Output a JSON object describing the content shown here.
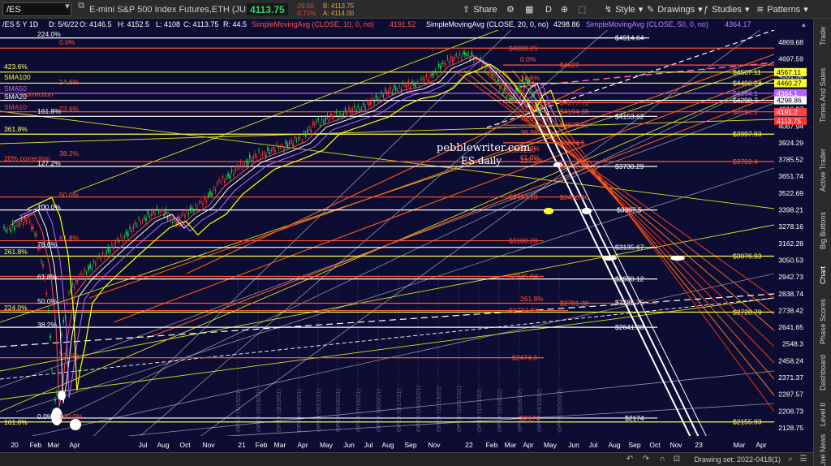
{
  "toolbar": {
    "symbol": "/ES",
    "description": "E-mini S&P 500 Index Futures,ETH (JUN 22)",
    "last_price": "4113.75",
    "change": "-29.50",
    "change_pct": "-0.71%",
    "bid": "B: 4113.75",
    "ask": "A: 4114.00",
    "share_label": "Share",
    "aggregation_label": "D",
    "style_label": "Style",
    "drawings_label": "Drawings",
    "studies_label": "Studies",
    "patterns_label": "Patterns"
  },
  "side_tabs": [
    "Trade",
    "Times And Sales",
    "Active Trader",
    "Big Buttons",
    "Chart",
    "Phase Scores",
    "Dashboard",
    "Level II",
    "Live News"
  ],
  "chart_header": {
    "title": "/ES 5 Y 1D",
    "date": "D: 5/6/22",
    "open": "O: 4146.5",
    "high": "H: 4152.5",
    "low": "L: 4108",
    "close": "C: 4113.75",
    "range": "R: 44.5",
    "sma10_label": "SimpleMovingAvg (CLOSE, 10, 0, no)",
    "sma10_value": "4191.52",
    "sma20_label": "SimpleMovingAvg (CLOSE, 20, 0, no)",
    "sma20_value": "4298.86",
    "sma50_label": "SimpleMovingAvg (CLOSE, 50, 0, no)",
    "sma50_value": "4364.17",
    "colors": {
      "sma10": "#ff4d4d",
      "sma20": "#ffffff",
      "sma50": "#b366ff"
    }
  },
  "watermark": {
    "line1": "pebblewriter.com",
    "line2": "ES daily"
  },
  "left_labels": [
    {
      "text": "224.0%",
      "color": "#ffffff"
    },
    {
      "text": "0.0%",
      "color": "#ff5533"
    },
    {
      "text": "423.6%",
      "color": "#ffff66"
    },
    {
      "text": "SMA100",
      "color": "#ffff00"
    },
    {
      "text": "14.6%",
      "color": "#ff5533"
    },
    {
      "text": "SMA50",
      "color": "#cc66ff"
    },
    {
      "text": "SMA20",
      "color": "#ffffff"
    },
    {
      "text": "correction",
      "color": "#ff5533"
    },
    {
      "text": "SMA10",
      "color": "#ff4444"
    },
    {
      "text": "23.6%",
      "color": "#ff5533"
    },
    {
      "text": "161.8%",
      "color": "#ffffff"
    },
    {
      "text": "361.8%",
      "color": "#ffff66"
    },
    {
      "text": "38.2%",
      "color": "#ff5533"
    },
    {
      "text": "20% correction",
      "color": "#ff5533"
    },
    {
      "text": "127.2%",
      "color": "#ffffff"
    },
    {
      "text": "50.0%",
      "color": "#ff5533"
    },
    {
      "text": "100.0%",
      "color": "#ffffff"
    },
    {
      "text": "61.8%",
      "color": "#ff5533"
    },
    {
      "text": "78.6%",
      "color": "#ffffff"
    },
    {
      "text": "261.8%",
      "color": "#ffff66"
    },
    {
      "text": "61.8%",
      "color": "#ffffff"
    },
    {
      "text": "50.0%",
      "color": "#ffffff"
    },
    {
      "text": "224.0%",
      "color": "#ffff66"
    },
    {
      "text": "38.2%",
      "color": "#ffffff"
    },
    {
      "text": "23.6%",
      "color": "#ff5533"
    },
    {
      "text": "0.0%",
      "color": "#ffffff"
    },
    {
      "text": "161.8%",
      "color": "#ffff66"
    },
    {
      "text": "100.0%",
      "color": "#ff5533"
    }
  ],
  "level_labels": [
    {
      "text": "$4914.64",
      "color": "#ffffff"
    },
    {
      "text": "$4808.25",
      "color": "#ff5533"
    },
    {
      "text": "$4637",
      "color": "#ff5533"
    },
    {
      "text": "$4567.11",
      "color": "#ffff66"
    },
    {
      "text": "$4460.24",
      "color": "#ffff66"
    },
    {
      "text": "$4364.1",
      "color": "#cc66ff"
    },
    {
      "text": "$4298.7",
      "color": "#ffffff"
    },
    {
      "text": "$4277.72",
      "color": "#ff5533"
    },
    {
      "text": "$4191.2",
      "color": "#ff4444"
    },
    {
      "text": "$4194.38",
      "color": "#ff5533"
    },
    {
      "text": "$4153.62",
      "color": "#ffffff"
    },
    {
      "text": "$4075.69",
      "color": "#ff5533"
    },
    {
      "text": "$3997.93",
      "color": "#ffff66"
    },
    {
      "text": "$3924.5",
      "color": "#ff5533"
    },
    {
      "text": "$3861.97",
      "color": "#ff5533"
    },
    {
      "text": "$3769.4",
      "color": "#ff5533"
    },
    {
      "text": "$3732.33",
      "color": "#ff5533"
    },
    {
      "text": "$3730.29",
      "color": "#ffffff"
    },
    {
      "text": "$3493.18",
      "color": "#ff5533"
    },
    {
      "text": "$3490.06",
      "color": "#ff5533"
    },
    {
      "text": "$3397.5",
      "color": "#ffffff"
    },
    {
      "text": "$3180.28",
      "color": "#ff5533"
    },
    {
      "text": "$3135.67",
      "color": "#ffffff"
    },
    {
      "text": "$3076.93",
      "color": "#ffff66"
    },
    {
      "text": "$2945.84",
      "color": "#ff5533"
    },
    {
      "text": "$2930.12",
      "color": "#ffffff"
    },
    {
      "text": "$2781.38",
      "color": "#ff5533"
    },
    {
      "text": "$2785.75",
      "color": "#ffffff"
    },
    {
      "text": "$2737.73",
      "color": "#ff5533"
    },
    {
      "text": "$2728.79",
      "color": "#ffff66"
    },
    {
      "text": "$2641.38",
      "color": "#ffffff"
    },
    {
      "text": "$2474.3",
      "color": "#ff5533"
    },
    {
      "text": "$2174",
      "color": "#ff5533"
    },
    {
      "text": "$2174",
      "color": "#ffffff"
    },
    {
      "text": "$2155.93",
      "color": "#ffff66"
    }
  ],
  "intermediate_labels": [
    "0.0%",
    "14.6%",
    "23.6%",
    "38.2%",
    "50.0%",
    "61.8%",
    "78.6%",
    "127.2%",
    "261.8%"
  ],
  "price_axis": [
    "4869.68",
    "4697.59",
    "4531.58",
    "4371.44",
    "4216.97",
    "4067.94",
    "3924.29",
    "3785.52",
    "3651.74",
    "3522.69",
    "3398.21",
    "3278.16",
    "3162.28",
    "3050.53",
    "2942.73",
    "2838.74",
    "2738.42",
    "2641.65",
    "2548.3",
    "2458.24",
    "2371.37",
    "2287.57",
    "2206.73",
    "2128.75"
  ],
  "axis_tags": [
    {
      "text": "4567.11",
      "bg": "#ffff33"
    },
    {
      "text": "4460.24",
      "bg": "#ffff33"
    },
    {
      "text": "4460.27",
      "bg": "#ffff33"
    },
    {
      "text": "4364.1",
      "bg": "#b366ff"
    },
    {
      "text": "4298.86",
      "bg": "#ffffff"
    },
    {
      "text": "4191.2",
      "bg": "#ff4444"
    },
    {
      "text": "4113.75",
      "bg": "#ff3333"
    }
  ],
  "time_axis": [
    "20",
    "Feb",
    "Mar",
    "Apr",
    "Jul",
    "Aug",
    "Oct",
    "Nov",
    "21",
    "Feb",
    "Mar",
    "Apr",
    "May",
    "Jun",
    "Jul",
    "Aug",
    "Sep",
    "Nov",
    "22",
    "Feb",
    "Mar",
    "Apr",
    "May",
    "Jun",
    "Jul",
    "Aug",
    "Sep",
    "Oct",
    "Nov",
    "23",
    "Mar",
    "Apr"
  ],
  "opex_labels": [
    "OPEX (1/15/21)",
    "OPEX (2/19/21)",
    "OPEX (3/19/21)",
    "OPEX (4/16/21)",
    "OPEX (5/21/21)",
    "OPEX (6/18/21)",
    "OPEX (7/16/21)",
    "OPEX (8/20/21)",
    "OPEX (9/17/21)",
    "OPEX (10/15/21)",
    "OPEX (11/19/21)",
    "OPEX (12/17/21)",
    "OPEX (1/21/22)",
    "OPEX (2/18/22)",
    "OPEX (3/18/22)",
    "OPEX (4/15/22)",
    "OPEX (5/20/22)"
  ],
  "footer": {
    "drawing_set": "Drawing set: 2022-0418(1)"
  }
}
